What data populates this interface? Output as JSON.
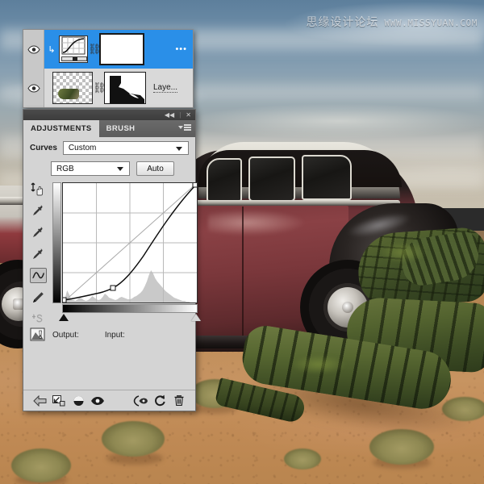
{
  "watermark": {
    "chinese": "思缘设计论坛",
    "english": "WWW.MISSYUAN.COM"
  },
  "layers_panel": {
    "name": "layers-panel",
    "rows": [
      {
        "selected": true,
        "visible": true,
        "kind": "curves-adjustment",
        "thumbnail_icon": "curves-thumbnail-icon",
        "mask_icon": "layer-mask-thumbnail",
        "link_icon": "link-chain-icon",
        "clip_icon": "clipping-mask-arrow-icon",
        "name": "",
        "overflow": "•••"
      },
      {
        "selected": false,
        "visible": true,
        "kind": "pixel-layer",
        "thumbnail_icon": "transparent-layer-thumbnail",
        "mask_icon": "layer-mask-thumbnail",
        "link_icon": "link-chain-icon",
        "name": "Laye..."
      }
    ]
  },
  "adjustments_panel": {
    "titlebar": {
      "collapse_label": "◀◀",
      "separator": "|",
      "close_label": "✕"
    },
    "tabs": [
      {
        "label": "ADJUSTMENTS",
        "active": true
      },
      {
        "label": "BRUSH",
        "active": false
      }
    ],
    "menu_icon": "panel-menu-icon",
    "preset": {
      "label": "Curves",
      "value": "Custom",
      "caret_icon": "chevron-down-icon"
    },
    "channel": {
      "value": "RGB",
      "caret_icon": "chevron-down-icon",
      "auto_label": "Auto"
    },
    "tools": [
      {
        "name": "on-image-adjust-tool",
        "icon": "hand-scrubby-icon",
        "selected": false
      },
      {
        "name": "black-point-eyedropper",
        "icon": "eyedropper-icon",
        "selected": false
      },
      {
        "name": "gray-point-eyedropper",
        "icon": "eyedropper-icon",
        "selected": false
      },
      {
        "name": "white-point-eyedropper",
        "icon": "eyedropper-icon",
        "selected": false
      },
      {
        "name": "curve-edit-tool",
        "icon": "curve-icon",
        "selected": true
      },
      {
        "name": "pencil-draw-tool",
        "icon": "pencil-icon",
        "selected": false
      },
      {
        "name": "smooth-curve-tool",
        "icon": "smooth-s-icon",
        "selected": false
      }
    ],
    "readouts": {
      "output_label": "Output:",
      "output_value": "",
      "input_label": "Input:",
      "input_value": "",
      "warning_icon": "clipping-warning-icon"
    },
    "footer_buttons": [
      {
        "name": "return-to-adjustment-list-button",
        "icon": "left-arrow-icon"
      },
      {
        "name": "expand-view-button",
        "icon": "expand-arrow-icon"
      },
      {
        "name": "clip-to-layer-button",
        "icon": "clip-to-layer-icon"
      },
      {
        "name": "toggle-layer-visibility-button",
        "icon": "eye-icon"
      },
      {
        "name": "preview-previous-state-button",
        "icon": "preview-eye-icon"
      },
      {
        "name": "reset-adjustment-button",
        "icon": "reset-circle-icon"
      },
      {
        "name": "delete-adjustment-layer-button",
        "icon": "trash-icon"
      }
    ]
  },
  "chart_data": {
    "type": "line",
    "title": "Curves",
    "xlabel": "Input",
    "ylabel": "Output",
    "xlim": [
      0,
      255
    ],
    "ylim": [
      0,
      255
    ],
    "grid": true,
    "grid_divisions": 4,
    "series": [
      {
        "name": "diagonal-baseline",
        "x": [
          0,
          255
        ],
        "y": [
          0,
          255
        ]
      },
      {
        "name": "rgb-curve",
        "control_points": [
          {
            "input": 0,
            "output": 4
          },
          {
            "input": 96,
            "output": 28
          },
          {
            "input": 255,
            "output": 255
          }
        ],
        "x": [
          0,
          32,
          64,
          96,
          128,
          160,
          192,
          224,
          255
        ],
        "y": [
          4,
          10,
          18,
          28,
          52,
          92,
          142,
          196,
          255
        ]
      }
    ],
    "histogram": {
      "name": "image-histogram",
      "bins": [
        2,
        10,
        26,
        18,
        8,
        5,
        4,
        6,
        9,
        7,
        5,
        4,
        5,
        7,
        12,
        9,
        6,
        5,
        4,
        6,
        11,
        18,
        14,
        9,
        7,
        6,
        5,
        6,
        8,
        10,
        9,
        7,
        6,
        6,
        7,
        9,
        11,
        13,
        16,
        19,
        24,
        31,
        40,
        52,
        46,
        36,
        29,
        24,
        20,
        17,
        14,
        11,
        9,
        7,
        5,
        4,
        3,
        2,
        2,
        1,
        1,
        1,
        0,
        0
      ]
    },
    "black_point_slider": 0,
    "white_point_slider": 255
  }
}
